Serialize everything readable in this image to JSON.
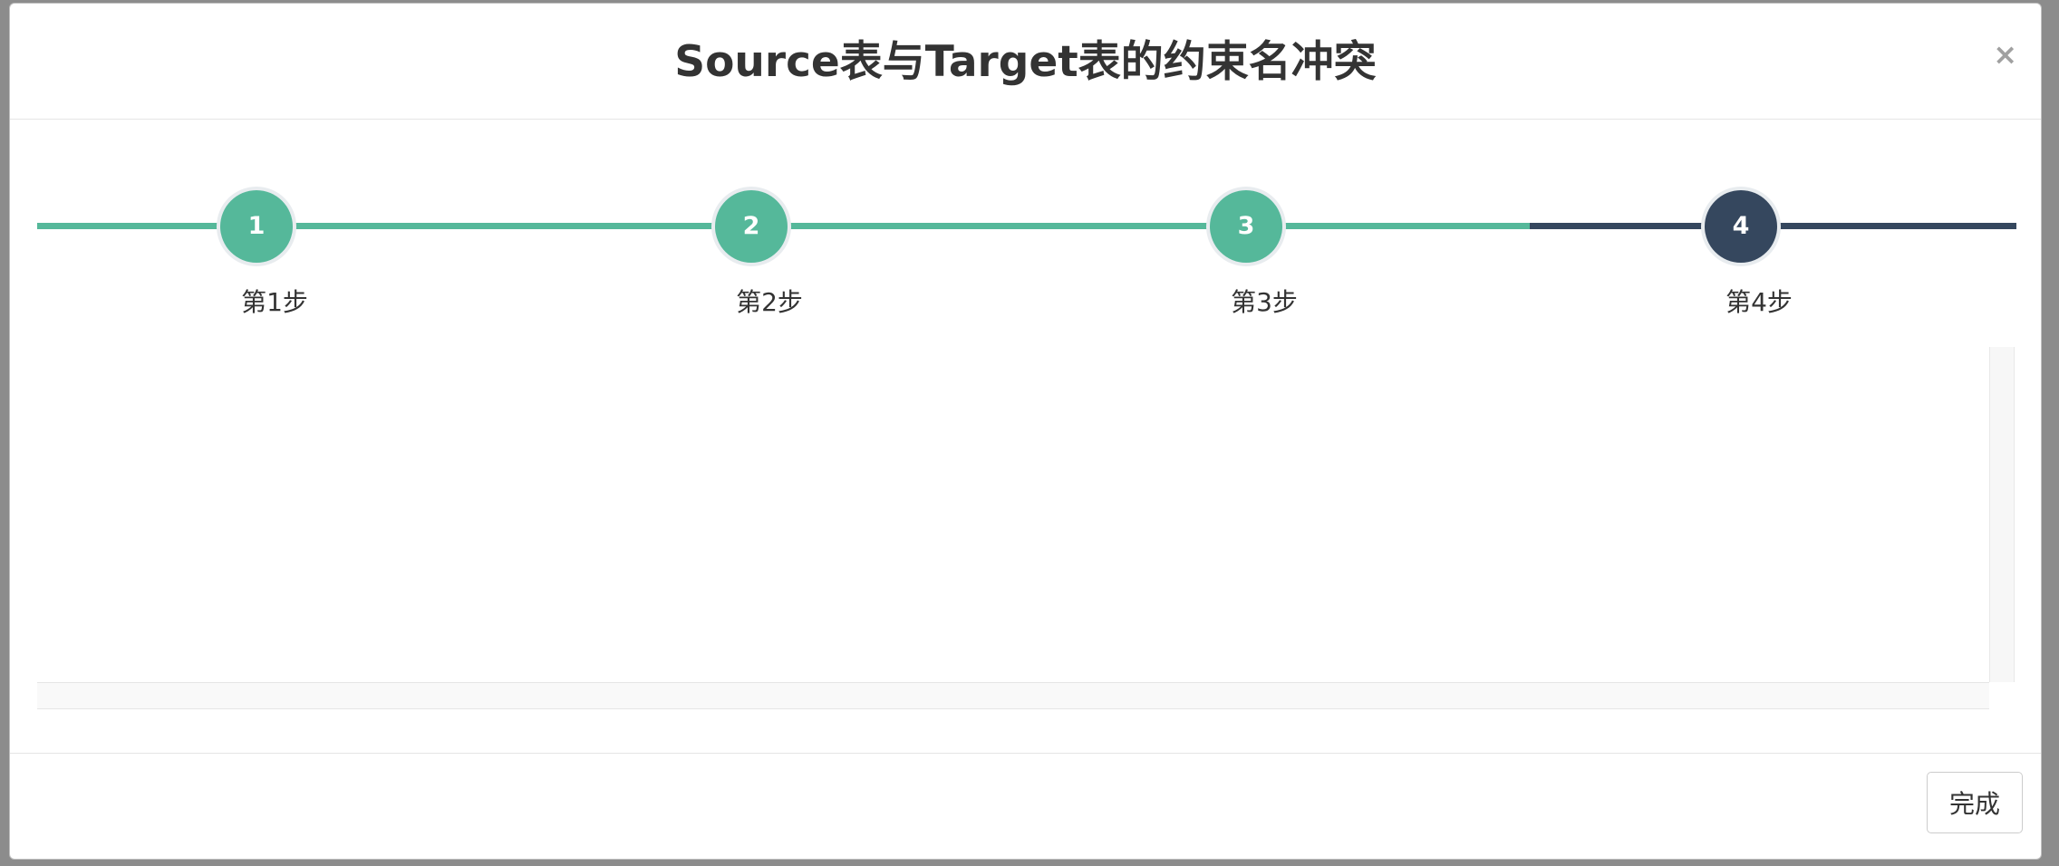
{
  "modal": {
    "title": "Source表与Target表的约束名冲突",
    "close_label": "×"
  },
  "wizard": {
    "steps": [
      {
        "number": "1",
        "label": "第1步",
        "state": "done"
      },
      {
        "number": "2",
        "label": "第2步",
        "state": "done"
      },
      {
        "number": "3",
        "label": "第3步",
        "state": "done"
      },
      {
        "number": "4",
        "label": "第4步",
        "state": "current"
      }
    ],
    "colors": {
      "done": "#55b89a",
      "current": "#35475e"
    }
  },
  "footer": {
    "finish_label": "完成"
  }
}
